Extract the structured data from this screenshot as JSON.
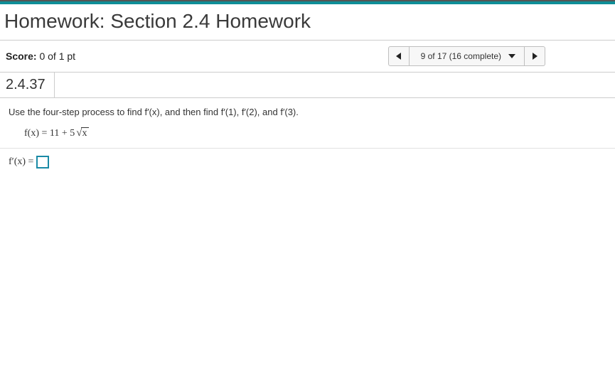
{
  "header": {
    "title": "Homework: Section 2.4 Homework"
  },
  "score": {
    "label": "Score:",
    "value": "0 of 1 pt"
  },
  "nav": {
    "position_text": "9 of 17 (16 complete)"
  },
  "problem": {
    "id": "2.4.37",
    "instruction": "Use the four-step process to find f′(x), and then find f′(1), f′(2), and f′(3).",
    "function_prefix": "f(x) = 11 + 5",
    "function_sqrt_arg": "x",
    "answer_label": "f′(x) =",
    "answer_value": ""
  }
}
